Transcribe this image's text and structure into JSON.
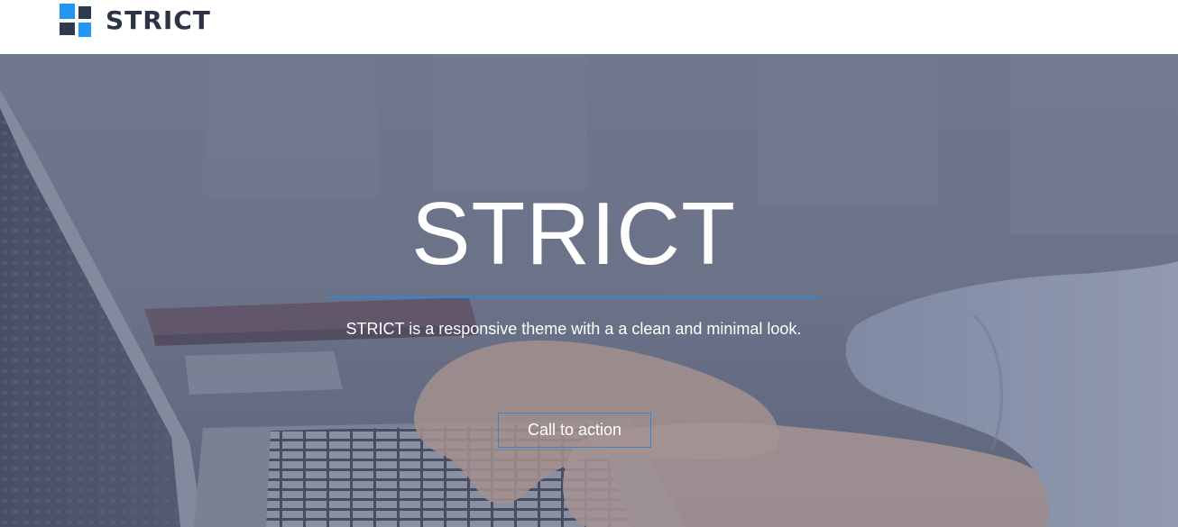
{
  "header": {
    "logo_text": "STRICT",
    "logo_icon": "four-squares-logo-icon"
  },
  "hero": {
    "title": "STRICT",
    "subtitle": "STRICT is a responsive theme with a a clean and minimal look.",
    "cta_label": "Call to action",
    "background_image": "laptop-typing-photo"
  },
  "colors": {
    "accent": "#2196f3",
    "brand_dark": "#2d3446",
    "divider": "#2a8ad6",
    "button_border": "#3b84c8"
  }
}
